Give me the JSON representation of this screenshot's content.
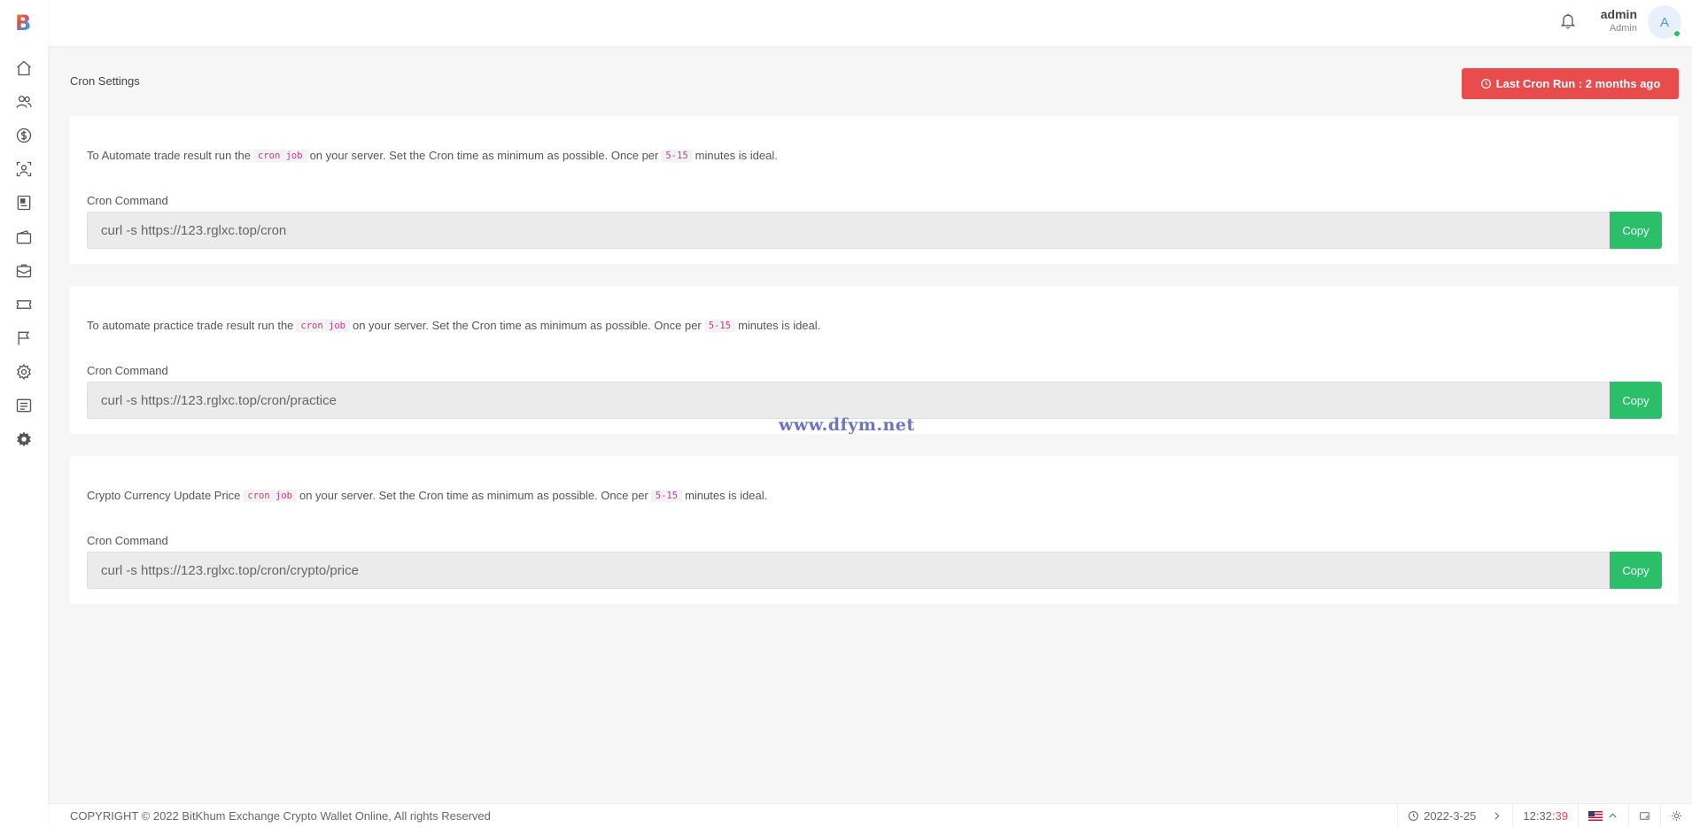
{
  "app": {
    "logo_letter": "B"
  },
  "sidebar": {
    "items": [
      {
        "name": "home-icon"
      },
      {
        "name": "users-icon"
      },
      {
        "name": "dollar-icon"
      },
      {
        "name": "kyc-icon"
      },
      {
        "name": "report-icon"
      },
      {
        "name": "wallet-icon"
      },
      {
        "name": "briefcase-icon"
      },
      {
        "name": "ticket-icon"
      },
      {
        "name": "flag-icon"
      },
      {
        "name": "settings-icon"
      },
      {
        "name": "notes-icon"
      },
      {
        "name": "gear-solid-icon"
      }
    ]
  },
  "header": {
    "user_name": "admin",
    "user_role": "Admin",
    "avatar_letter": "A"
  },
  "page": {
    "title": "Cron Settings",
    "last_cron_label": "Last Cron Run : 2 months ago"
  },
  "cards": [
    {
      "text_before": "To Automate trade result run the",
      "tag1": "cron job",
      "text_middle": "on your server. Set the Cron time as minimum as possible. Once per",
      "tag2": "5-15",
      "text_after": "minutes is ideal.",
      "label": "Cron Command",
      "command": "curl -s https://123.rglxc.top/cron",
      "copy_label": "Copy"
    },
    {
      "text_before": "To automate practice trade result run the",
      "tag1": "cron job",
      "text_middle": "on your server. Set the Cron time as minimum as possible. Once per",
      "tag2": "5-15",
      "text_after": "minutes is ideal.",
      "label": "Cron Command",
      "command": "curl -s https://123.rglxc.top/cron/practice",
      "copy_label": "Copy"
    },
    {
      "text_before": "Crypto Currency Update Price",
      "tag1": "cron job",
      "text_middle": "on your server. Set the Cron time as minimum as possible. Once per",
      "tag2": "5-15",
      "text_after": "minutes is ideal.",
      "label": "Cron Command",
      "command": "curl -s https://123.rglxc.top/cron/crypto/price",
      "copy_label": "Copy"
    }
  ],
  "watermark": "www.dfym.net",
  "footer": {
    "copyright": "COPYRIGHT © 2022 BitKhum Exchange Crypto Wallet Online, All rights Reserved",
    "date": "2022-3-25",
    "time_hm": "12:32:",
    "time_s": "39"
  },
  "colors": {
    "accent_red": "#e84c4c",
    "accent_green": "#2bbf6a",
    "tag_pink": "#d63384"
  }
}
